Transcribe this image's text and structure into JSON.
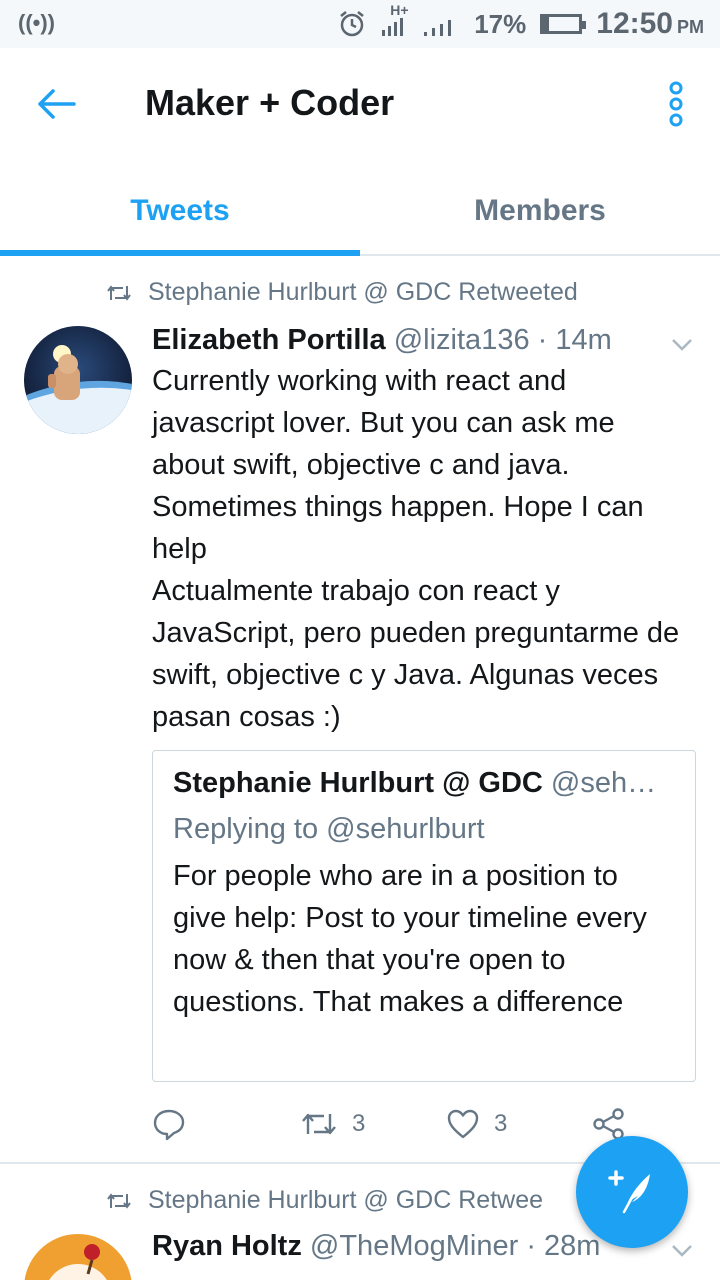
{
  "status_bar": {
    "signal_glyph": "((•))",
    "network": "H+",
    "battery": "17%",
    "battery_level": 0.17,
    "time": "12:50",
    "ampm": "PM"
  },
  "app_bar": {
    "title": "Maker + Coder",
    "back_icon": "arrow-left-icon",
    "more_icon": "vertical-dots-icon",
    "accent": "#1da1f2"
  },
  "tabs": [
    {
      "label": "Tweets",
      "active": true
    },
    {
      "label": "Members",
      "active": false
    }
  ],
  "tweets": [
    {
      "retweet_label": "Stephanie Hurlburt @ GDC Retweeted",
      "name": "Elizabeth Portilla",
      "handle": "@lizita136",
      "separator": "·",
      "time": "14m",
      "text": "Currently working with react and javascript lover. But you can ask me about swift, objective c and java. Sometimes things happen. Hope I can help\nActualmente trabajo con react y JavaScript, pero pueden preguntarme de swift, objective c y Java. Algunas veces pasan cosas :)",
      "quote": {
        "name": "Stephanie Hurlburt @ GDC",
        "handle": "@seh…",
        "reply_to": "Replying to @sehurlburt",
        "text": "For people who are in a position to give help: Post to your timeline every now & then that you're open to questions. That makes a difference"
      },
      "retweets": "3",
      "likes": "3"
    },
    {
      "retweet_label": "Stephanie Hurlburt @ GDC Retwee",
      "name": "Ryan Holtz",
      "handle": "@TheMogMiner",
      "separator": "·",
      "time": "28m"
    }
  ],
  "fab": {
    "icon": "compose-tweet-icon"
  }
}
